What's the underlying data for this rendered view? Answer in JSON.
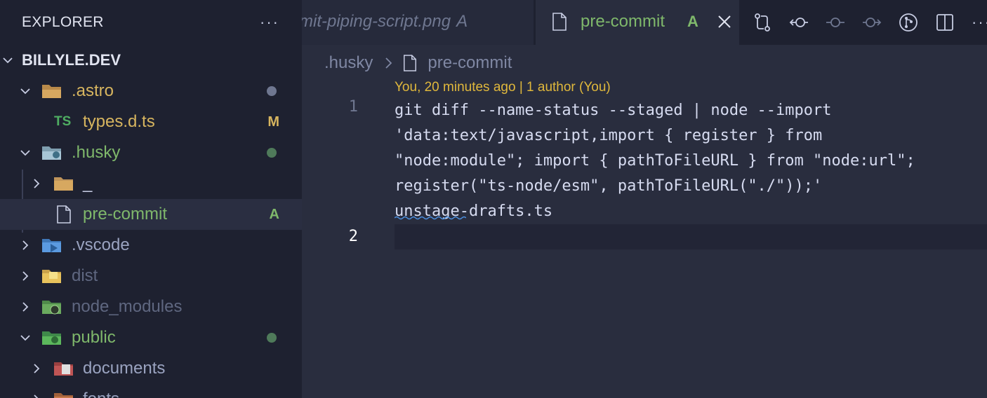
{
  "sidebar": {
    "title": "EXPLORER",
    "more_label": "···",
    "root": "BILLYLE.DEV",
    "items": [
      {
        "label": ".astro",
        "status": "dot"
      },
      {
        "label": "types.d.ts",
        "icon_text": "TS",
        "status": "M"
      },
      {
        "label": ".husky",
        "status": "dot"
      },
      {
        "label": "_",
        "status": ""
      },
      {
        "label": "pre-commit",
        "status": "A"
      },
      {
        "label": ".vscode",
        "status": ""
      },
      {
        "label": "dist",
        "status": ""
      },
      {
        "label": "node_modules",
        "status": ""
      },
      {
        "label": "public",
        "status": "dot"
      },
      {
        "label": "documents",
        "status": ""
      },
      {
        "label": "fonts",
        "status": ""
      }
    ]
  },
  "tabs": [
    {
      "label": "mit-piping-script.png",
      "status": "A"
    },
    {
      "label": "pre-commit",
      "status": "A"
    }
  ],
  "toolbar": {
    "more_label": "···"
  },
  "breadcrumb": {
    "folder": ".husky",
    "file": "pre-commit"
  },
  "editor": {
    "blame": "You, 20 minutes ago | 1 author (You)",
    "lines": [
      {
        "number": "1",
        "text": "git diff --name-status --staged | node --import\n'data:text/javascript,import { register } from\n\"node:module\"; import { pathToFileURL } from \"node:url\";\nregister(\"ts-node/esm\", pathToFileURL(\"./\"));'\nunstage-drafts.ts"
      },
      {
        "number": "2",
        "text": ""
      }
    ]
  },
  "colors": {
    "sidebar_bg": "#1e2130",
    "editor_bg": "#292d3e",
    "added_green": "#7fb86b",
    "modified_yellow": "#d7b55f",
    "blame_yellow": "#e0b83c"
  }
}
